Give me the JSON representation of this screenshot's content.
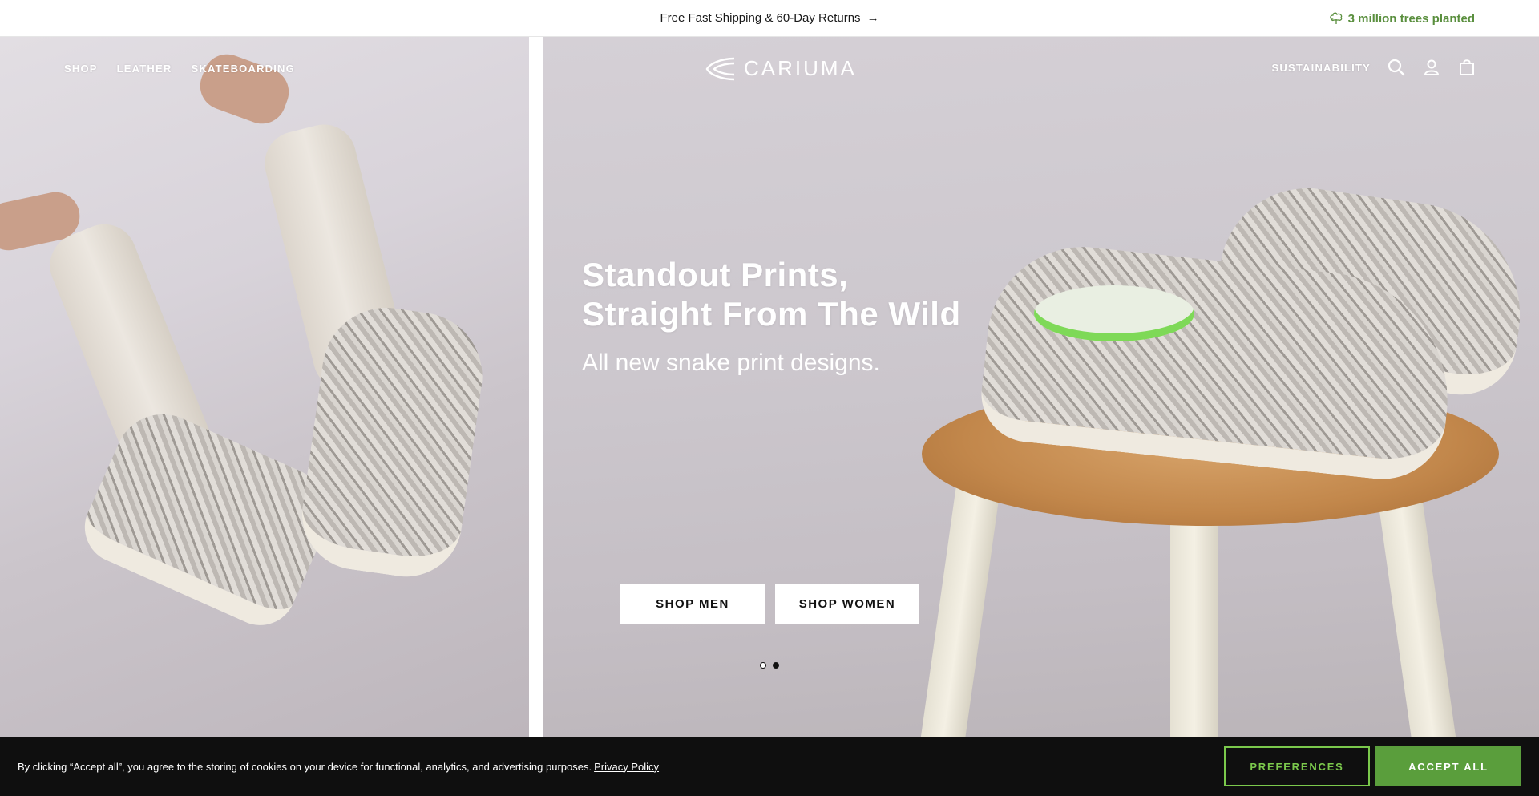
{
  "announcement": {
    "text": "Free Fast Shipping & 60-Day Returns",
    "arrow_icon": "arrow-right-icon"
  },
  "impact": {
    "text": "3 million trees planted",
    "icon": "tree-icon",
    "color": "#5a8f3e"
  },
  "nav": {
    "left_items": [
      "SHOP",
      "LEATHER",
      "SKATEBOARDING"
    ],
    "logo_text": "CARIUMA",
    "right_link": "SUSTAINABILITY",
    "icons": [
      "search-icon",
      "account-icon",
      "bag-icon"
    ]
  },
  "hero": {
    "title_line_1": "Standout Prints,",
    "title_line_2": "Straight From The Wild",
    "subtitle": "All new snake print designs.",
    "cta_men": "SHOP MEN",
    "cta_women": "SHOP WOMEN",
    "slide_count": 2,
    "active_slide": 2
  },
  "cookie": {
    "message": "By clicking “Accept all”, you agree to the storing of cookies on your device for functional, analytics, and advertising purposes.",
    "link": "Privacy Policy",
    "preferences_label": "PREFERENCES",
    "accept_label": "ACCEPT ALL",
    "accent_color": "#5a9e3c"
  }
}
